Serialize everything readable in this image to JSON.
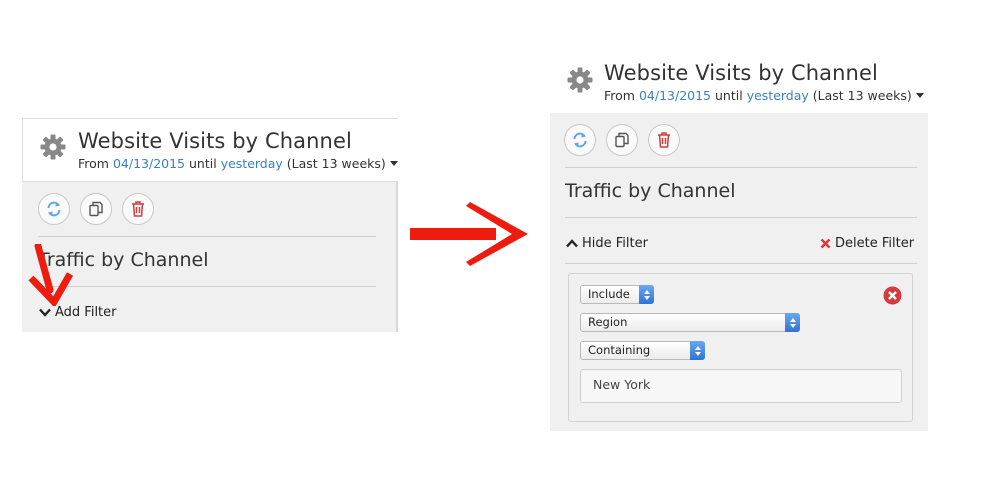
{
  "before": {
    "title": "Website Visits by Channel",
    "date_prefix": "From",
    "start_date": "04/13/2015",
    "date_mid": "until",
    "end_date": "yesterday",
    "range_label": "(Last 13 weeks)",
    "section_title": "Traffic by Channel",
    "add_filter_label": "Add Filter"
  },
  "after": {
    "title": "Website Visits by Channel",
    "date_prefix": "From",
    "start_date": "04/13/2015",
    "date_mid": "until",
    "end_date": "yesterday",
    "range_label": "(Last 13 weeks)",
    "section_title": "Traffic by Channel",
    "hide_filter_label": "Hide Filter",
    "delete_filter_label": "Delete Filter",
    "filter": {
      "mode": "Include",
      "field": "Region",
      "operator": "Containing",
      "value": "New York"
    }
  },
  "icons": {
    "gear": "gear-icon",
    "refresh": "refresh-icon",
    "copy": "copy-icon",
    "delete": "trash-icon",
    "arrow_big": "arrow-right-icon",
    "arrow_callout": "arrow-down-left-icon",
    "delete_x": "x-icon",
    "remove_circle": "remove-circle-icon"
  },
  "colors": {
    "link": "#3c7fc2",
    "refresh": "#5fa8e0",
    "danger": "#d23c3c",
    "annotation_arrow": "#ee1c0f",
    "select_arrow": "#2f73d6"
  }
}
